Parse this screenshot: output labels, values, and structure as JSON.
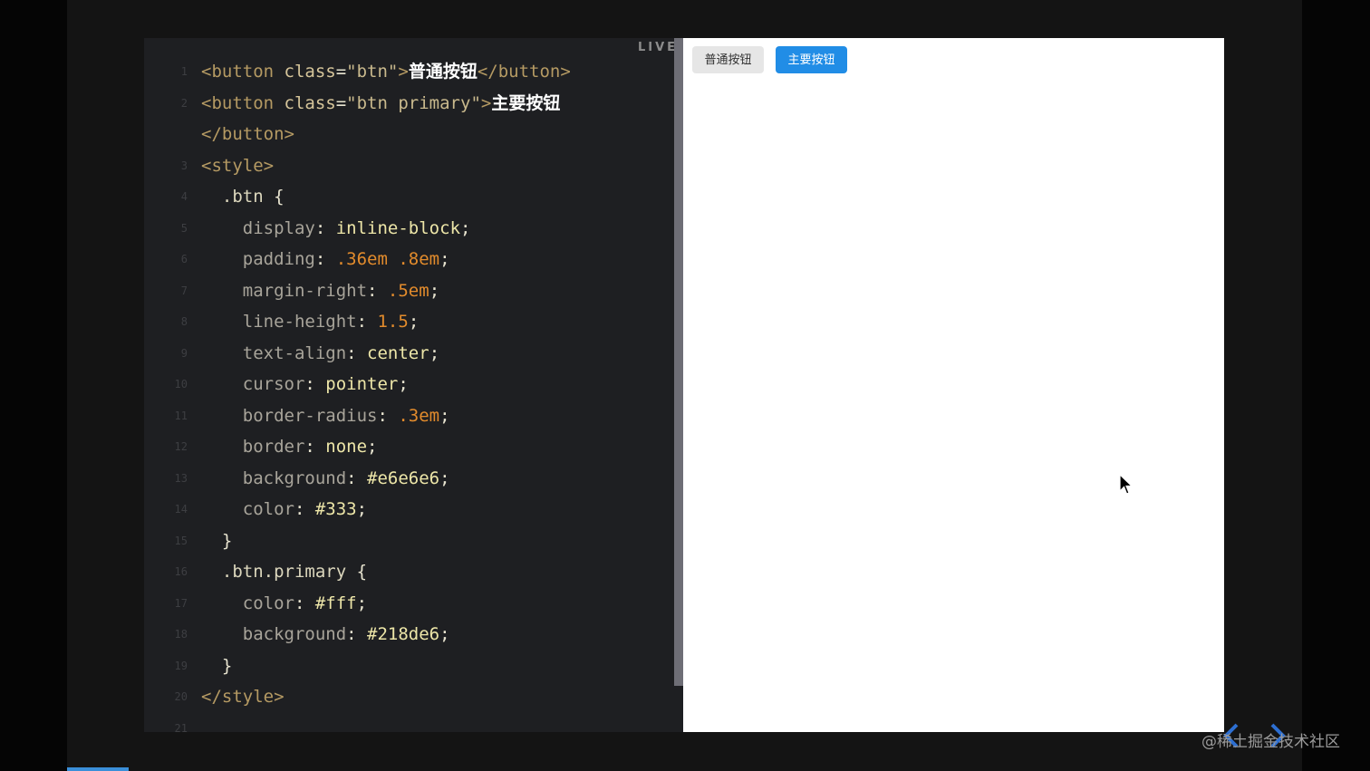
{
  "editor": {
    "live_label": "LIVE",
    "lines": [
      {
        "n": "1",
        "fold": true,
        "parts": [
          [
            "tag",
            "<button "
          ],
          [
            "attr",
            "class"
          ],
          [
            "punc",
            "="
          ],
          [
            "str",
            "\"btn\""
          ],
          [
            "tag",
            ">"
          ],
          [
            "cn",
            "普通按钮"
          ],
          [
            "tag",
            "</button>"
          ]
        ]
      },
      {
        "n": "2",
        "fold": true,
        "parts": [
          [
            "tag",
            "<button "
          ],
          [
            "attr",
            "class"
          ],
          [
            "punc",
            "="
          ],
          [
            "str",
            "\"btn primary\""
          ],
          [
            "tag",
            ">"
          ],
          [
            "cn",
            "主要按钮"
          ]
        ]
      },
      {
        "n": "",
        "fold": false,
        "parts": [
          [
            "tag",
            "</button>"
          ]
        ]
      },
      {
        "n": "3",
        "fold": true,
        "parts": [
          [
            "tag",
            "<style>"
          ]
        ]
      },
      {
        "n": "4",
        "fold": true,
        "parts": [
          [
            "sel",
            "  .btn "
          ],
          [
            "punc",
            "{"
          ]
        ]
      },
      {
        "n": "5",
        "fold": false,
        "parts": [
          [
            "prop",
            "    display"
          ],
          [
            "punc",
            ": "
          ],
          [
            "val",
            "inline-block"
          ],
          [
            "punc",
            ";"
          ]
        ]
      },
      {
        "n": "6",
        "fold": false,
        "parts": [
          [
            "prop",
            "    padding"
          ],
          [
            "punc",
            ": "
          ],
          [
            "num",
            ".36em .8em"
          ],
          [
            "punc",
            ";"
          ]
        ]
      },
      {
        "n": "7",
        "fold": false,
        "parts": [
          [
            "prop",
            "    margin-right"
          ],
          [
            "punc",
            ": "
          ],
          [
            "num",
            ".5em"
          ],
          [
            "punc",
            ";"
          ]
        ]
      },
      {
        "n": "8",
        "fold": false,
        "parts": [
          [
            "prop",
            "    line-height"
          ],
          [
            "punc",
            ": "
          ],
          [
            "num",
            "1.5"
          ],
          [
            "punc",
            ";"
          ]
        ]
      },
      {
        "n": "9",
        "fold": false,
        "parts": [
          [
            "prop",
            "    text-align"
          ],
          [
            "punc",
            ": "
          ],
          [
            "val",
            "center"
          ],
          [
            "punc",
            ";"
          ]
        ]
      },
      {
        "n": "10",
        "fold": false,
        "parts": [
          [
            "prop",
            "    cursor"
          ],
          [
            "punc",
            ": "
          ],
          [
            "val",
            "pointer"
          ],
          [
            "punc",
            ";"
          ]
        ]
      },
      {
        "n": "11",
        "fold": false,
        "parts": [
          [
            "prop",
            "    border-radius"
          ],
          [
            "punc",
            ": "
          ],
          [
            "num",
            ".3em"
          ],
          [
            "punc",
            ";"
          ]
        ]
      },
      {
        "n": "12",
        "fold": false,
        "parts": [
          [
            "prop",
            "    border"
          ],
          [
            "punc",
            ": "
          ],
          [
            "val",
            "none"
          ],
          [
            "punc",
            ";"
          ]
        ]
      },
      {
        "n": "13",
        "fold": false,
        "parts": [
          [
            "prop",
            "    background"
          ],
          [
            "punc",
            ": "
          ],
          [
            "val",
            "#e6e6e6"
          ],
          [
            "punc",
            ";"
          ]
        ]
      },
      {
        "n": "14",
        "fold": false,
        "parts": [
          [
            "prop",
            "    color"
          ],
          [
            "punc",
            ": "
          ],
          [
            "val",
            "#333"
          ],
          [
            "punc",
            ";"
          ]
        ]
      },
      {
        "n": "15",
        "fold": false,
        "parts": [
          [
            "punc",
            "  }"
          ]
        ]
      },
      {
        "n": "16",
        "fold": true,
        "parts": [
          [
            "sel",
            "  .btn.primary "
          ],
          [
            "punc",
            "{"
          ]
        ]
      },
      {
        "n": "17",
        "fold": false,
        "parts": [
          [
            "prop",
            "    color"
          ],
          [
            "punc",
            ": "
          ],
          [
            "val",
            "#fff"
          ],
          [
            "punc",
            ";"
          ]
        ]
      },
      {
        "n": "18",
        "fold": false,
        "parts": [
          [
            "prop",
            "    background"
          ],
          [
            "punc",
            ": "
          ],
          [
            "val",
            "#218de6"
          ],
          [
            "punc",
            ";"
          ]
        ]
      },
      {
        "n": "19",
        "fold": false,
        "parts": [
          [
            "punc",
            "  }"
          ]
        ]
      },
      {
        "n": "20",
        "fold": false,
        "parts": [
          [
            "tag",
            "</style>"
          ]
        ]
      },
      {
        "n": "21",
        "fold": false,
        "parts": []
      }
    ]
  },
  "preview": {
    "normal_button": "普通按钮",
    "primary_button": "主要按钮"
  },
  "watermark": "@稀土掘金技术社区",
  "colors": {
    "primary": "#218de6",
    "normal_bg": "#e6e6e6",
    "normal_text": "#333333"
  },
  "icons": {
    "cursor": "arrow-pointer-icon",
    "prev": "chevron-left-icon",
    "next": "chevron-right-icon"
  }
}
